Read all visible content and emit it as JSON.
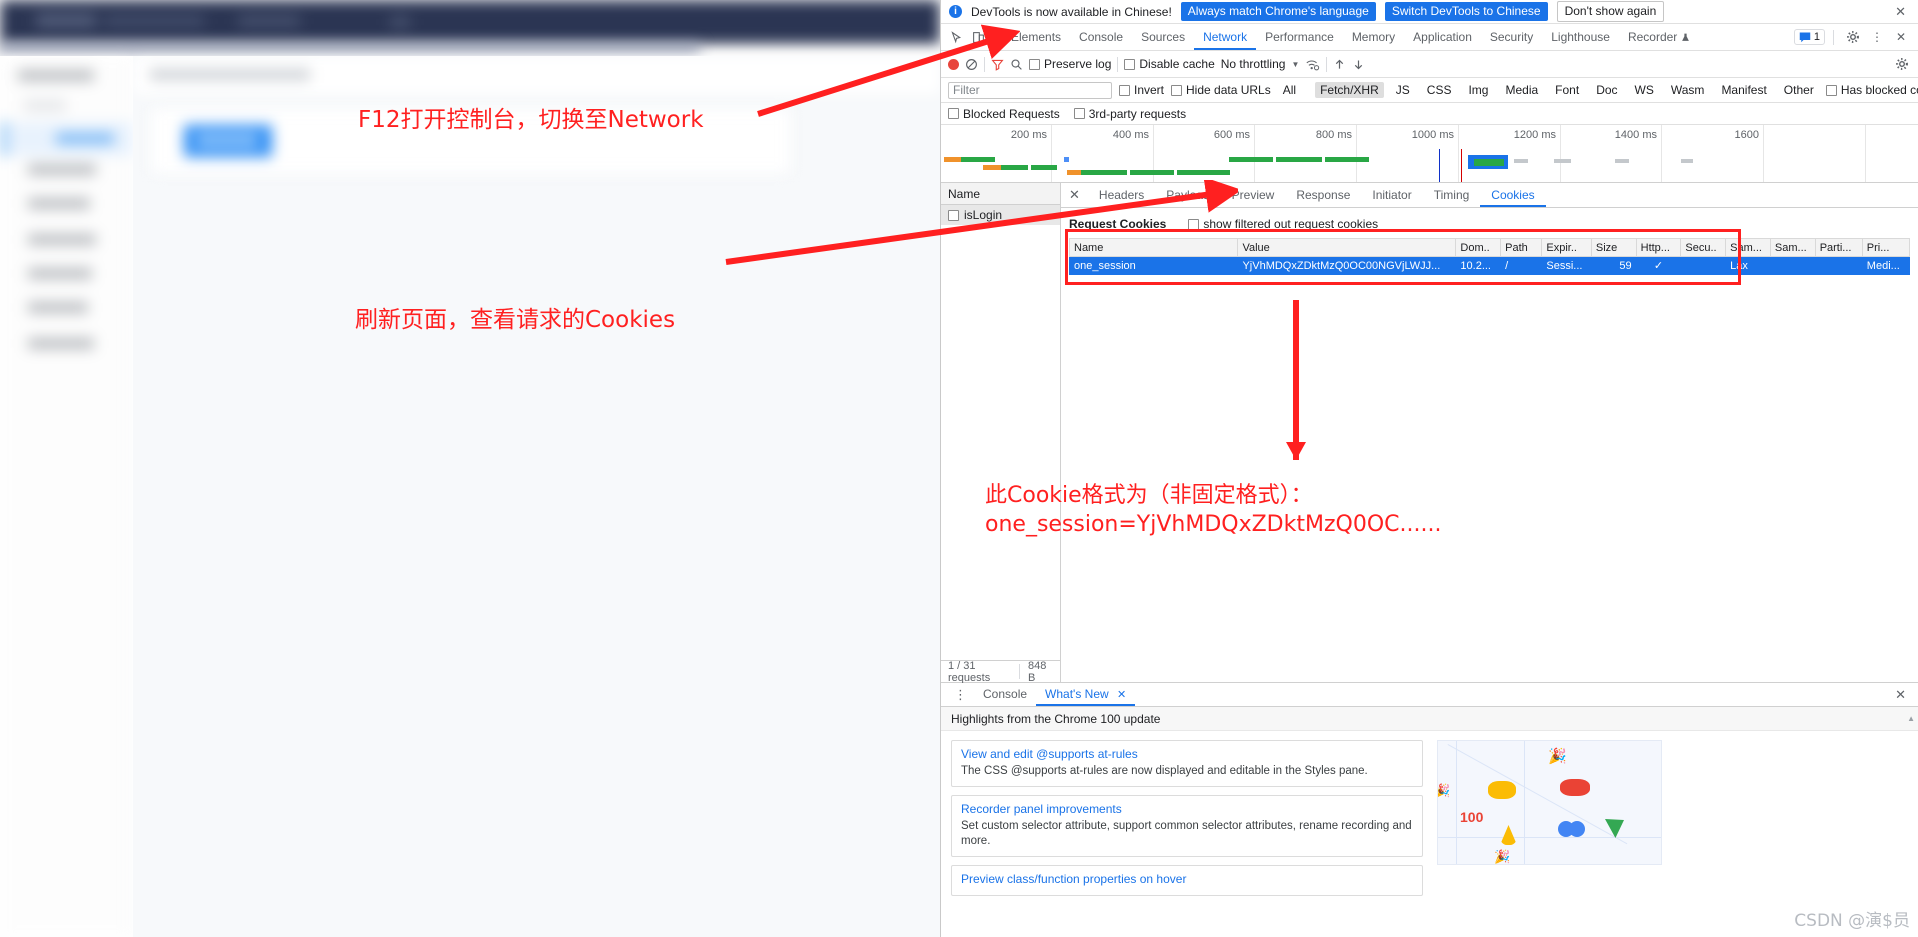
{
  "devtools": {
    "banner": {
      "icon": "info-icon",
      "message": "DevTools is now available in Chinese!",
      "btn_match_language": "Always match Chrome's language",
      "btn_switch_chinese": "Switch DevTools to Chinese",
      "btn_dont_show": "Don't show again",
      "close": "✕"
    },
    "main_tabs": [
      {
        "label": "Elements",
        "active": false
      },
      {
        "label": "Console",
        "active": false
      },
      {
        "label": "Sources",
        "active": false
      },
      {
        "label": "Network",
        "active": true
      },
      {
        "label": "Performance",
        "active": false
      },
      {
        "label": "Memory",
        "active": false
      },
      {
        "label": "Application",
        "active": false
      },
      {
        "label": "Security",
        "active": false
      },
      {
        "label": "Lighthouse",
        "active": false
      },
      {
        "label": "Recorder",
        "active": false
      }
    ],
    "tabbar_right": {
      "message_count": "1",
      "settings": "gear-icon",
      "more": "⋮",
      "close": "✕"
    },
    "network_toolbar": {
      "record": "record-button",
      "clear": "clear-button",
      "filter_toggle": "filter-funnel-icon",
      "search": "search-icon",
      "preserve_log": "Preserve log",
      "disable_cache": "Disable cache",
      "throttling": "No throttling",
      "import": "import-har-icon",
      "export": "export-har-icon",
      "settings": "gear-icon"
    },
    "filter_bar": {
      "placeholder": "Filter",
      "value": "",
      "invert": "Invert",
      "hide_data_urls": "Hide data URLs",
      "types": [
        {
          "label": "All",
          "active": false
        },
        {
          "label": "Fetch/XHR",
          "active": true
        },
        {
          "label": "JS",
          "active": false
        },
        {
          "label": "CSS",
          "active": false
        },
        {
          "label": "Img",
          "active": false
        },
        {
          "label": "Media",
          "active": false
        },
        {
          "label": "Font",
          "active": false
        },
        {
          "label": "Doc",
          "active": false
        },
        {
          "label": "WS",
          "active": false
        },
        {
          "label": "Wasm",
          "active": false
        },
        {
          "label": "Manifest",
          "active": false
        },
        {
          "label": "Other",
          "active": false
        }
      ],
      "has_blocked_cookies": "Has blocked cookies",
      "blocked_requests": "Blocked Requests",
      "third_party": "3rd-party requests"
    },
    "timeline": {
      "ticks": [
        "200 ms",
        "400 ms",
        "600 ms",
        "800 ms",
        "1000 ms",
        "1200 ms",
        "1400 ms",
        "1600"
      ]
    },
    "request_list": {
      "column_name": "Name",
      "rows": [
        {
          "name": "isLogin",
          "selected": true
        }
      ],
      "status_requests": "1 / 31 requests",
      "status_size": "848 B"
    },
    "detail_tabs": [
      {
        "label": "Headers",
        "active": false
      },
      {
        "label": "Payload",
        "active": false
      },
      {
        "label": "Preview",
        "active": false
      },
      {
        "label": "Response",
        "active": false
      },
      {
        "label": "Initiator",
        "active": false
      },
      {
        "label": "Timing",
        "active": false
      },
      {
        "label": "Cookies",
        "active": true
      }
    ],
    "cookies": {
      "section_title": "Request Cookies",
      "show_filtered_label": "show filtered out request cookies",
      "columns": [
        "Name",
        "Value",
        "Dom..",
        "Path",
        "Expir..",
        "Size",
        "Http...",
        "Secu..",
        "Sam...",
        "Sam...",
        "Parti...",
        "Pri..."
      ],
      "rows": [
        {
          "name": "one_session",
          "value": "YjVhMDQxZDktMzQ0OC00NGVjLWJJ...",
          "domain": "10.2...",
          "path": "/",
          "expires": "Sessi...",
          "size": "59",
          "http_only": "✓",
          "secure": "",
          "samesite": "Lax",
          "samesite2": "",
          "partition": "",
          "priority": "Medi...",
          "selected": true
        }
      ]
    },
    "drawer": {
      "tabs": [
        {
          "label": "Console",
          "active": false,
          "closable": false
        },
        {
          "label": "What's New",
          "active": true,
          "closable": true
        }
      ],
      "close": "✕",
      "whats_new_title": "Highlights from the Chrome 100 update",
      "cards": [
        {
          "link": "View and edit @supports at-rules",
          "desc": "The CSS @supports at-rules are now displayed and editable in the Styles pane."
        },
        {
          "link": "Recorder panel improvements",
          "desc": "Set custom selector attribute, support common selector attributes, rename recording and more."
        },
        {
          "link": "Preview class/function properties on hover",
          "desc": ""
        }
      ],
      "hundred_badge": "100"
    }
  },
  "annotations": {
    "note1": "F12打开控制台，切换至Network",
    "note2": "刷新页面，查看请求的Cookies",
    "note3_line1": "此Cookie格式为（非固定格式）：",
    "note3_line2": "one_session=YjVhMDQxZDktMzQ0OC......"
  },
  "watermark": "CSDN @演$员",
  "colors": {
    "accent_blue": "#1a73e8",
    "annotation_red": "#ff2020",
    "record_red": "#e8453c",
    "waterfall_green": "#29a745",
    "waterfall_orange": "#f0922b"
  }
}
